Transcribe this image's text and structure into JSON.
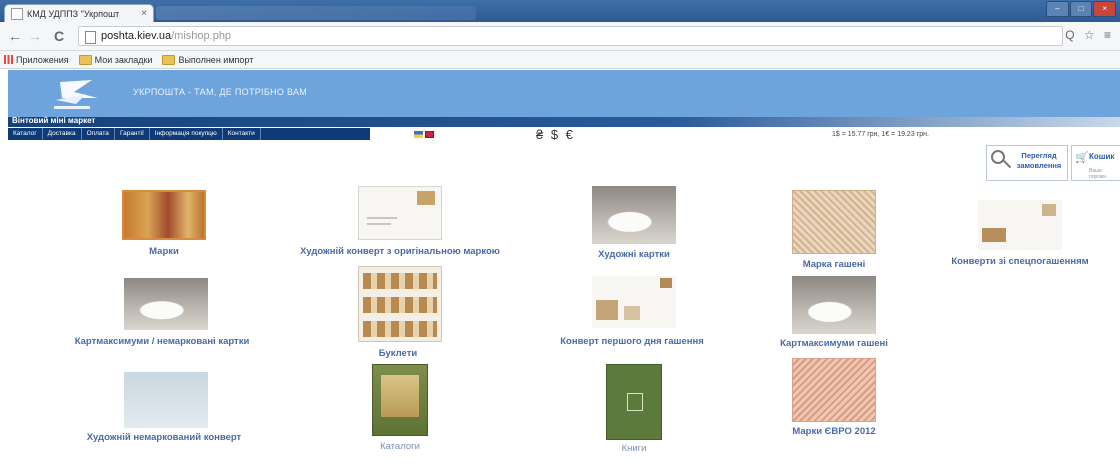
{
  "browser": {
    "tab_title": "КМД УДППЗ \"Укрпошт",
    "tab_close": "×",
    "window_controls": [
      "–",
      "□",
      "×"
    ],
    "back_icon": "←",
    "forward_icon": "→",
    "reload_icon": "C",
    "url_host": "poshta.kiev.ua",
    "url_path": "/mishop.php",
    "toolbar_icons": "Q ☆ ≡",
    "bookmarks": [
      {
        "label": "Приложения",
        "icon": "apps-icon"
      },
      {
        "label": "Мои закладки",
        "icon": "folder-icon"
      },
      {
        "label": "Выполнен импорт",
        "icon": "folder-icon"
      }
    ]
  },
  "site": {
    "slogan": "УКРПОШТА - ТАМ, ДЕ ПОТРІБНО ВАМ",
    "shop_title": "Вінтовий міні маркет",
    "menu": [
      "Каталог",
      "Доставка",
      "Оплата",
      "Гарантії",
      "Інформація покупцю",
      "Контакти"
    ],
    "currency_symbols": "₴ $ €",
    "rates": "1$ = 15.77 грн,  1€ = 19.23 грн.",
    "track_button": "Перегляд замовлення",
    "cart_label": "Кошик",
    "cart_sub": "Ваше порожн",
    "cart_icon": "cart-icon",
    "accent_color": "#6da4dc",
    "menu_color": "#0e3a78",
    "caption_color": "#4a6aa6"
  },
  "catalog": [
    {
      "label": "Марки"
    },
    {
      "label": "Художній конверт з оригінальною маркою"
    },
    {
      "label": "Художні картки"
    },
    {
      "label": "Марка гашені"
    },
    {
      "label": "Конверти зі спецпогашенням"
    },
    {
      "label": "Картмаксимуми / немарковані картки"
    },
    {
      "label": "Буклети"
    },
    {
      "label": "Конверт першого дня гашення"
    },
    {
      "label": "Картмаксимуми гашені"
    },
    {
      "label": "Художній немаркований конверт"
    },
    {
      "label": "Каталоги"
    },
    {
      "label": "Книги"
    },
    {
      "label": "Марки ЄВРО 2012"
    }
  ]
}
